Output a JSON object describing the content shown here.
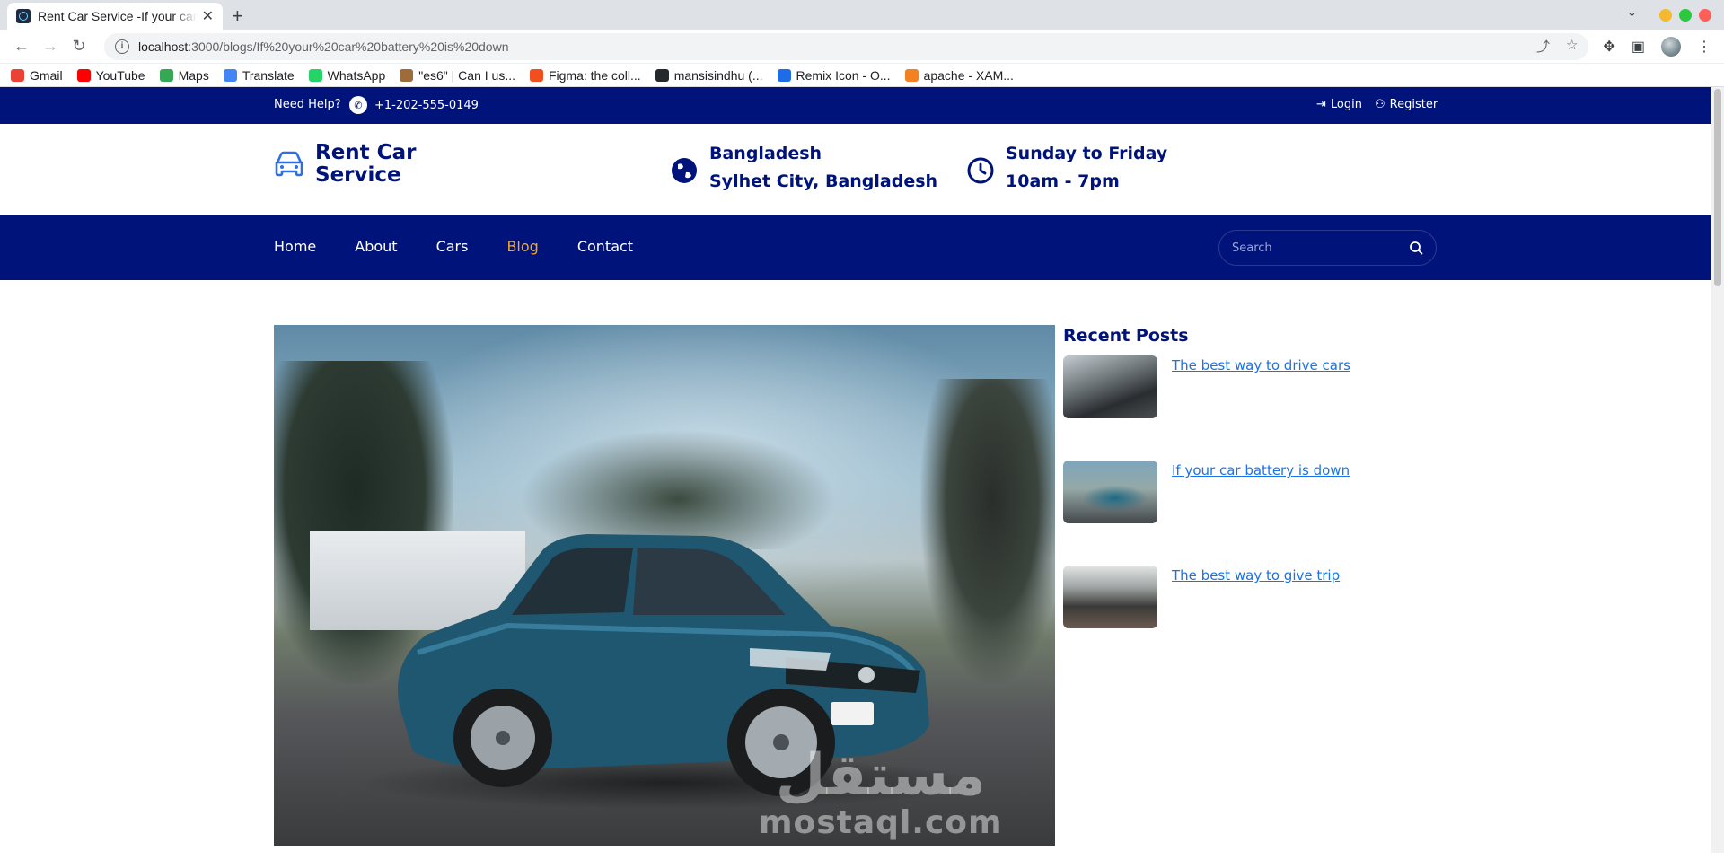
{
  "browser": {
    "tab_title": "Rent Car Service -If your car battery is down",
    "url_host": "localhost",
    "url_rest": ":3000/blogs/If%20your%20car%20battery%20is%20down",
    "bookmarks": [
      {
        "label": "Gmail",
        "icon": "gmail-icon",
        "color": "#ea4335"
      },
      {
        "label": "YouTube",
        "icon": "youtube-icon",
        "color": "#ff0000"
      },
      {
        "label": "Maps",
        "icon": "maps-icon",
        "color": "#34a853"
      },
      {
        "label": "Translate",
        "icon": "translate-icon",
        "color": "#4285f4"
      },
      {
        "label": "WhatsApp",
        "icon": "whatsapp-icon",
        "color": "#25d366"
      },
      {
        "label": "\"es6\" | Can I us...",
        "icon": "caniuse-icon",
        "color": "#9e6b3b"
      },
      {
        "label": "Figma: the coll...",
        "icon": "figma-icon",
        "color": "#f24e1e"
      },
      {
        "label": "mansisindhu (...",
        "icon": "github-icon",
        "color": "#24292e"
      },
      {
        "label": "Remix Icon - O...",
        "icon": "remix-icon",
        "color": "#1e6ce8"
      },
      {
        "label": "apache - XAM...",
        "icon": "stackoverflow-icon",
        "color": "#f48024"
      }
    ],
    "window_controls": [
      "#f5b82e",
      "#2bc840",
      "#ff5f57"
    ]
  },
  "topbar": {
    "help": "Need Help?",
    "phone": "+1-202-555-0149",
    "login": "Login",
    "register": "Register"
  },
  "brand": {
    "name_line1": "Rent Car",
    "name_line2": "Service",
    "location_title": "Bangladesh",
    "location_sub": "Sylhet City, Bangladesh",
    "hours_title": "Sunday to Friday",
    "hours_sub": "10am - 7pm"
  },
  "nav": {
    "items": [
      {
        "label": "Home",
        "active": false
      },
      {
        "label": "About",
        "active": false
      },
      {
        "label": "Cars",
        "active": false
      },
      {
        "label": "Blog",
        "active": true
      },
      {
        "label": "Contact",
        "active": false
      }
    ],
    "search_placeholder": "Search"
  },
  "sidebar": {
    "title": "Recent Posts",
    "posts": [
      {
        "title": "The best way to drive cars"
      },
      {
        "title": "If your car battery is down"
      },
      {
        "title": "The best way to give trip"
      }
    ]
  },
  "hero": {
    "watermark_arabic": "مستقل",
    "watermark_latin": "mostaql.com"
  },
  "colors": {
    "primary": "#00137a",
    "accent": "#f5a623",
    "link": "#1a73e8"
  }
}
